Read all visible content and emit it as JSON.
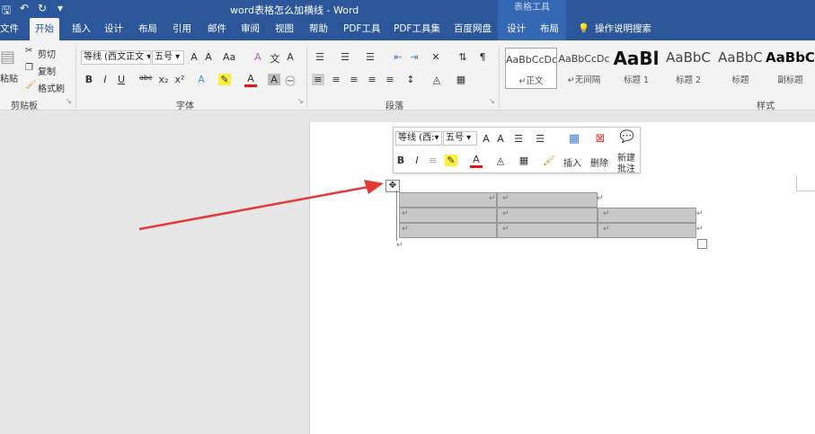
{
  "titlebar": {
    "title": "word表格怎么加横线 - Word",
    "table_tools": "表格工具"
  },
  "tabs": [
    {
      "label": "文件"
    },
    {
      "label": "开始"
    },
    {
      "label": "插入"
    },
    {
      "label": "设计"
    },
    {
      "label": "布局"
    },
    {
      "label": "引用"
    },
    {
      "label": "邮件"
    },
    {
      "label": "审阅"
    },
    {
      "label": "视图"
    },
    {
      "label": "帮助"
    },
    {
      "label": "PDF工具"
    },
    {
      "label": "PDF工具集"
    },
    {
      "label": "百度网盘"
    },
    {
      "label": "设计"
    },
    {
      "label": "布局"
    },
    {
      "label": "操作说明搜索"
    }
  ],
  "clipboard": {
    "paste": "粘贴",
    "cut": "剪切",
    "copy": "复制",
    "format_painter": "格式刷",
    "group": "剪贴板"
  },
  "font": {
    "font_name": "等线 (西文正文",
    "font_size": "五号",
    "group": "字体"
  },
  "paragraph": {
    "group": "段落"
  },
  "styles": {
    "group": "样式",
    "items": [
      {
        "sample": "AaBbCcDc",
        "name": "↵正文"
      },
      {
        "sample": "AaBbCcDc",
        "name": "↵无间隔"
      },
      {
        "sample": "AaBl",
        "name": "标题 1"
      },
      {
        "sample": "AaBbC",
        "name": "标题 2"
      },
      {
        "sample": "AaBbC",
        "name": "标题"
      },
      {
        "sample": "AaBbC",
        "name": "副标题"
      }
    ]
  },
  "mini_toolbar": {
    "font_name": "等线 (西:",
    "font_size": "五号",
    "insert": "插入",
    "delete": "删除",
    "new_comment_1": "新建",
    "new_comment_2": "批注"
  },
  "table_marks": {
    "cell_end": "↵",
    "para_mark": "↵"
  },
  "colors": {
    "word_blue": "#2b579a",
    "arrow_red": "#e53935",
    "table_fill": "#c8c8c8"
  }
}
